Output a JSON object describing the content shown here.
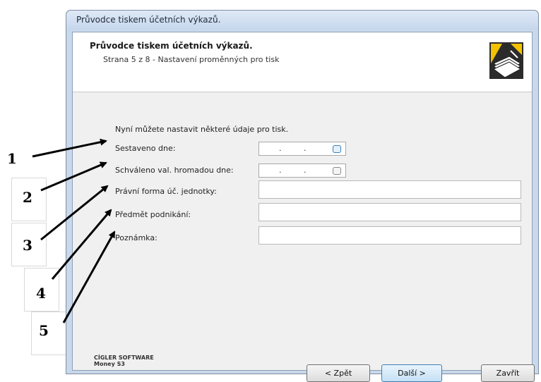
{
  "window": {
    "title": "Průvodce tiskem účetních výkazů."
  },
  "header": {
    "title": "Průvodce tiskem účetních výkazů.",
    "subtitle": "Strana 5 z 8 - Nastavení proměnných pro tisk",
    "icon": "printer-papers-icon"
  },
  "form": {
    "intro": "Nyní můžete nastavit některé údaje pro tisk.",
    "fields": [
      {
        "label": "Sestaveno dne:",
        "value": " .  .",
        "type": "date"
      },
      {
        "label": "Schváleno val. hromadou dne:",
        "value": " .  .",
        "type": "date"
      },
      {
        "label": "Právní forma úč. jednotky:",
        "value": "",
        "type": "text"
      },
      {
        "label": "Předmět podnikání:",
        "value": "",
        "type": "text"
      },
      {
        "label": "Poznámka:",
        "value": "",
        "type": "text"
      }
    ]
  },
  "brand": {
    "line1": "CÍGLER SOFTWARE",
    "line2": "Money S3"
  },
  "buttons": {
    "back": "< Zpět",
    "next": "Další >",
    "close": "Zavřít"
  },
  "annotations": [
    "1",
    "2",
    "3",
    "4",
    "5"
  ]
}
